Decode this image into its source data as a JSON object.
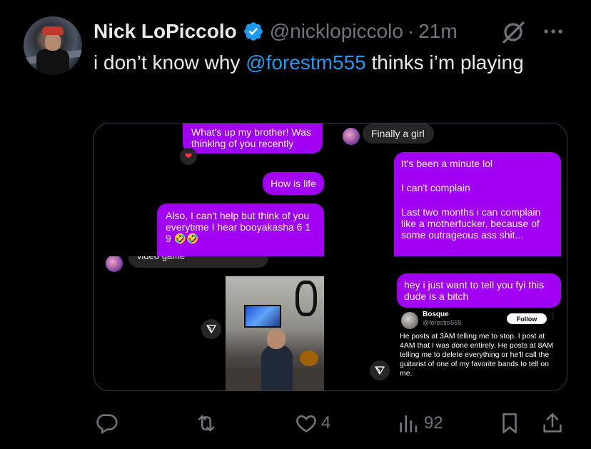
{
  "author": {
    "name": "Nick LoPiccolo",
    "handle": "@nicklopiccolo",
    "separator": "·",
    "time": "21m"
  },
  "tweet": {
    "text_before": "i don’t know why ",
    "mention": "@forestm555",
    "text_after": " thinks i’m playing"
  },
  "media": {
    "panel1": {
      "bubble_top": "What's up my brother! Was thinking of you recently",
      "reaction": "❤",
      "bubble_mid": "How is life",
      "bubble_bottom": "Also, I can't help but think of you everytime I hear booyakasha 6 1 9 🤣🤣"
    },
    "panel2": {
      "gray_bubble": "Finally a girl",
      "bubble_line1": "It's been a minute lol",
      "bubble_line2": "I can't complain",
      "bubble_line3": "Last two months i can complain like a motherfucker, because of some outrageous ass shit..."
    },
    "panel3": {
      "gray_bubble": "video game"
    },
    "panel4": {
      "bubble": "hey i just want to tell you fyi this dude is a bitch",
      "quote_name": "Bosque",
      "quote_handle": "@forestm555",
      "quote_follow": "Follow",
      "quote_dots": "⋮",
      "quote_body": "He posts at 3AM telling me to stop. I post at 4AM that I was done entirely. He posts at 8AM telling me to delete everything or he'll call the guitarist of one of my favorite bands to tell on me."
    }
  },
  "actions": {
    "reply_count": "",
    "repost_count": "",
    "like_count": "4",
    "views_count": "92"
  },
  "colors": {
    "accent": "#1d9bf0",
    "bubble_purple": "#a100f2",
    "muted": "#71767b"
  },
  "icons": [
    "verified-badge-icon",
    "grok-icon",
    "more-icon",
    "reply-icon",
    "repost-icon",
    "like-icon",
    "views-icon",
    "bookmark-icon",
    "share-icon",
    "heart-reaction-icon",
    "send-icon"
  ]
}
